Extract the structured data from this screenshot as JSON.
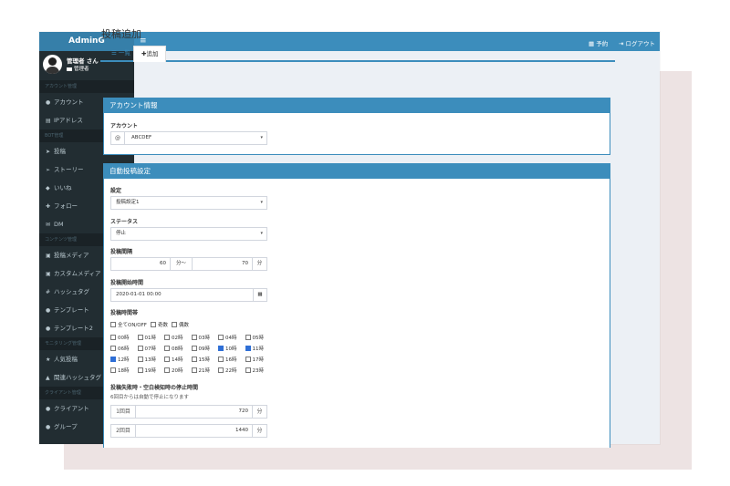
{
  "app": {
    "logo": "AdminG"
  },
  "user": {
    "name": "管理者 さん",
    "role": "管理者"
  },
  "topbar": {
    "menu_icon": "hamburger-icon",
    "reserve": "予約",
    "logout": "ログアウト"
  },
  "sidebar": {
    "sections": [
      {
        "header": "アカウント管理",
        "items": [
          {
            "icon": "user-icon",
            "label": "アカウント"
          },
          {
            "icon": "list-icon",
            "label": "IPアドレス"
          }
        ]
      },
      {
        "header": "BOT管理",
        "items": [
          {
            "icon": "send-icon",
            "label": "投稿"
          },
          {
            "icon": "send-outline-icon",
            "label": "ストーリー"
          },
          {
            "icon": "thumbs-up-icon",
            "label": "いいね"
          },
          {
            "icon": "user-plus-icon",
            "label": "フォロー"
          },
          {
            "icon": "envelope-icon",
            "label": "DM"
          }
        ]
      },
      {
        "header": "コンテンツ管理",
        "items": [
          {
            "icon": "image-icon",
            "label": "投稿メディア"
          },
          {
            "icon": "image-icon",
            "label": "カスタムメディア"
          },
          {
            "icon": "hashtag-icon",
            "label": "ハッシュタグ"
          },
          {
            "icon": "comment-icon",
            "label": "テンプレート"
          },
          {
            "icon": "comment-icon",
            "label": "テンプレート2"
          }
        ]
      },
      {
        "header": "モニタリング管理",
        "items": [
          {
            "icon": "star-icon",
            "label": "人気投稿"
          },
          {
            "icon": "sitemap-icon",
            "label": "関連ハッシュタグ"
          }
        ]
      },
      {
        "header": "クライアント管理",
        "items": [
          {
            "icon": "user-icon",
            "label": "クライアント"
          },
          {
            "icon": "users-icon",
            "label": "グループ"
          }
        ]
      }
    ]
  },
  "page": {
    "title": "投稿追加"
  },
  "tabs": {
    "list": "一覧",
    "add": "追加"
  },
  "account_panel": {
    "title": "アカウント情報",
    "label": "アカウント",
    "prefix": "@",
    "value": "ABCDEF"
  },
  "auto_panel": {
    "title": "自動投稿設定",
    "setting_label": "設定",
    "setting_value": "投稿設定1",
    "status_label": "ステータス",
    "status_value": "停止",
    "interval_label": "投稿間隔",
    "interval_min": "60",
    "interval_sep": "分〜",
    "interval_max": "70",
    "interval_unit": "分",
    "start_label": "投稿開始時間",
    "start_value": "2020-01-01 00:00",
    "hours_label": "投稿時間帯",
    "toggles": [
      {
        "label": "全てON/OFF",
        "checked": false
      },
      {
        "label": "奇数",
        "checked": false
      },
      {
        "label": "偶数",
        "checked": false
      }
    ],
    "hours": [
      {
        "label": "00時",
        "checked": false
      },
      {
        "label": "01時",
        "checked": false
      },
      {
        "label": "02時",
        "checked": false
      },
      {
        "label": "03時",
        "checked": false
      },
      {
        "label": "04時",
        "checked": false
      },
      {
        "label": "05時",
        "checked": false
      },
      {
        "label": "06時",
        "checked": false
      },
      {
        "label": "07時",
        "checked": false
      },
      {
        "label": "08時",
        "checked": false
      },
      {
        "label": "09時",
        "checked": false
      },
      {
        "label": "10時",
        "checked": true
      },
      {
        "label": "11時",
        "checked": true
      },
      {
        "label": "12時",
        "checked": true
      },
      {
        "label": "13時",
        "checked": false
      },
      {
        "label": "14時",
        "checked": false
      },
      {
        "label": "15時",
        "checked": false
      },
      {
        "label": "16時",
        "checked": false
      },
      {
        "label": "17時",
        "checked": false
      },
      {
        "label": "18時",
        "checked": false
      },
      {
        "label": "19時",
        "checked": false
      },
      {
        "label": "20時",
        "checked": false
      },
      {
        "label": "21時",
        "checked": false
      },
      {
        "label": "22時",
        "checked": false
      },
      {
        "label": "23時",
        "checked": false
      }
    ],
    "fail_label": "投稿失敗時・空白検知時の停止時間",
    "fail_hint": "6回目からは自動で停止になります",
    "fail_rows": [
      {
        "label": "1回目",
        "value": "720",
        "unit": "分"
      },
      {
        "label": "2回目",
        "value": "1440",
        "unit": "分"
      }
    ]
  }
}
